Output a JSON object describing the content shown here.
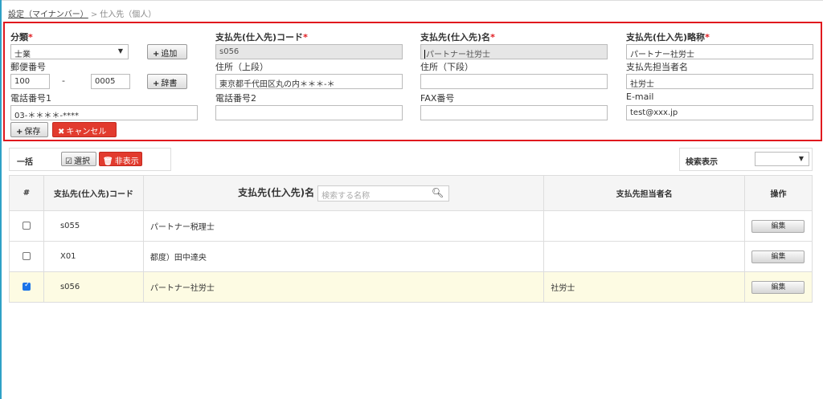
{
  "breadcrumb": {
    "link": "設定（マイナンバー）",
    "separator": ">",
    "current": "仕入先（個人）"
  },
  "form": {
    "category_label": "分類",
    "category_value": "士業",
    "add_button": "追加",
    "postal_label": "郵便番号",
    "postal_1": "100",
    "postal_sep": "-",
    "postal_2": "0005",
    "dictionary_button": "辞書",
    "phone1_label": "電話番号1",
    "phone1_value": "03-＊＊＊＊-****",
    "save_button": "保存",
    "cancel_button": "キャンセル",
    "code_label": "支払先(仕入先)コード",
    "code_value": "s056",
    "address1_label": "住所（上段）",
    "address1_value": "東京都千代田区丸の内＊＊＊-＊",
    "phone2_label": "電話番号2",
    "phone2_value": "",
    "name_label": "支払先(仕入先)名",
    "name_value": "パートナー社労士",
    "address2_label": "住所（下段）",
    "address2_value": "",
    "fax_label": "FAX番号",
    "fax_value": "",
    "short_label": "支払先(仕入先)略称",
    "short_value": "パートナー社労士",
    "contact_label": "支払先担当者名",
    "contact_value": "社労士",
    "email_label": "E-mail",
    "email_value": "test@xxx.jp",
    "required_mark": "*"
  },
  "bulk": {
    "label": "一括",
    "select_button": "選択",
    "hide_button": "非表示"
  },
  "search_display": {
    "label": "検索表示",
    "value": ""
  },
  "table": {
    "headers": {
      "num": "#",
      "code": "支払先(仕入先)コード",
      "name": "支払先(仕入先)名",
      "contact": "支払先担当者名",
      "action": "操作"
    },
    "search_placeholder": "検索する名称",
    "edit_label": "編集",
    "rows": [
      {
        "code": "s055",
        "name": "パートナー税理士",
        "contact": "",
        "checked": false
      },
      {
        "code": "X01",
        "name": "都度）田中達央",
        "contact": "",
        "checked": false
      },
      {
        "code": "s056",
        "name": "パートナー社労士",
        "contact": "社労士",
        "checked": true
      }
    ]
  },
  "colors": {
    "accent_red": "#e0191e",
    "selected_row": "#fdfbe3",
    "checkbox_blue": "#1a73e8"
  }
}
